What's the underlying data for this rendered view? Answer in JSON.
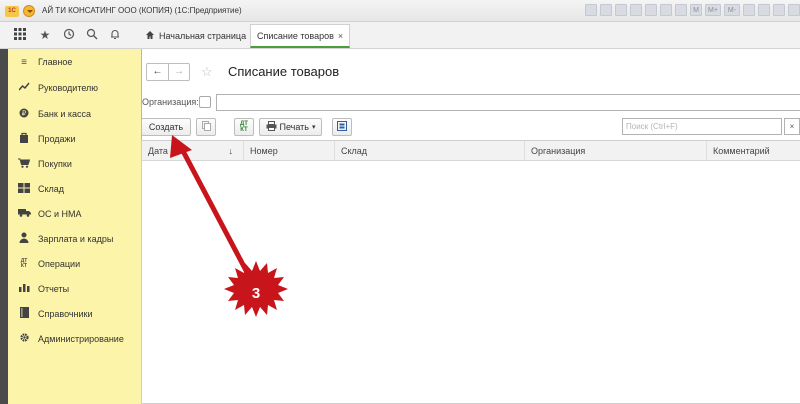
{
  "window": {
    "title": "АЙ ТИ КОНСАТИНГ ООО (КОПИЯ)  (1С:Предприятие)",
    "logo_text": "1С",
    "toolbar_glyphs": [
      "M",
      "M+",
      "M-"
    ]
  },
  "tabs": {
    "home_label": "Начальная страница",
    "active_label": "Списание товаров",
    "close_glyph": "×"
  },
  "sidebar": {
    "items": [
      {
        "label": "Главное",
        "icon": "menu-icon"
      },
      {
        "label": "Руководителю",
        "icon": "trend-icon"
      },
      {
        "label": "Банк и касса",
        "icon": "coin-icon"
      },
      {
        "label": "Продажи",
        "icon": "bag-icon"
      },
      {
        "label": "Покупки",
        "icon": "cart-icon"
      },
      {
        "label": "Склад",
        "icon": "warehouse-icon"
      },
      {
        "label": "ОС и НМА",
        "icon": "truck-icon"
      },
      {
        "label": "Зарплата и кадры",
        "icon": "person-icon"
      },
      {
        "label": "Операции",
        "icon": "dt-kt-icon"
      },
      {
        "label": "Отчеты",
        "icon": "bar-chart-icon"
      },
      {
        "label": "Справочники",
        "icon": "book-icon"
      },
      {
        "label": "Администрирование",
        "icon": "gear-icon"
      }
    ]
  },
  "page": {
    "title": "Списание товаров",
    "org_label": "Организация:",
    "create_label": "Создать",
    "dtkt_label": "ДТ КТ",
    "print_label": "Печать",
    "search_placeholder": "Поиск (Ctrl+F)",
    "search_clear": "×"
  },
  "table": {
    "columns": [
      "Дата",
      "Номер",
      "Склад",
      "Организация",
      "Комментарий"
    ],
    "sort_glyph": "↓",
    "rows": []
  },
  "annotation": {
    "badge_number": "3",
    "color": "#c8151b"
  }
}
